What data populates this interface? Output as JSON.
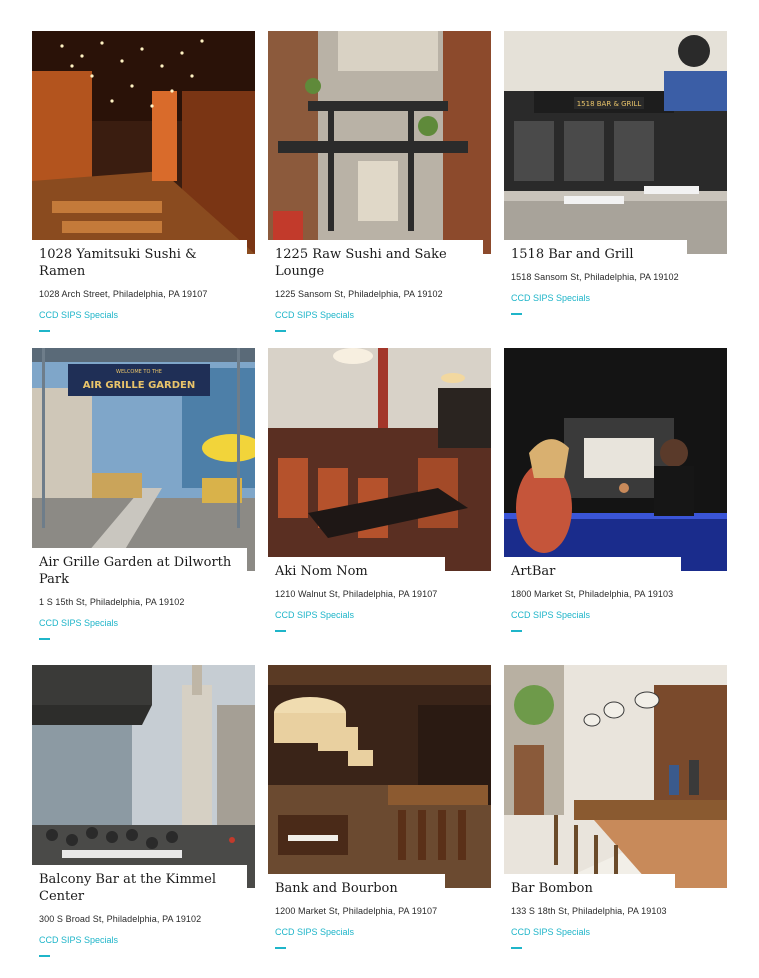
{
  "colors": {
    "accent": "#1fb5c9",
    "text": "#1b1b1b",
    "background": "#ffffff"
  },
  "listings": [
    {
      "name": "1028 Yamitsuki Sushi & Ramen",
      "address": "1028 Arch Street, Philadelphia, PA 19107",
      "tag": "CCD SIPS Specials",
      "image": "restaurant-interior-string-lights"
    },
    {
      "name": "1225 Raw Sushi and Sake Lounge",
      "address": "1225 Sansom St, Philadelphia, PA 19102",
      "tag": "CCD SIPS Specials",
      "image": "courtyard-patio-pergola"
    },
    {
      "name": "1518 Bar and Grill",
      "address": "1518 Sansom St, Philadelphia, PA 19102",
      "tag": "CCD SIPS Specials",
      "image": "storefront-sidewalk-tables",
      "sign_text": "1518 BAR & GRILL"
    },
    {
      "name": "Air Grille Garden at Dilworth Park",
      "address": "1 S 15th St, Philadelphia, PA 19102",
      "tag": "CCD SIPS Specials",
      "image": "outdoor-beer-garden",
      "sign_text": "AIR GRILLE GARDEN",
      "sign_small": "WELCOME TO THE"
    },
    {
      "name": "Aki Nom Nom",
      "address": "1210 Walnut St, Philadelphia, PA 19107",
      "tag": "CCD SIPS Specials",
      "image": "dining-room-red-booths"
    },
    {
      "name": "ArtBar",
      "address": "1800 Market St, Philadelphia, PA 19103",
      "tag": "CCD SIPS Specials",
      "image": "bartender-serving-guest"
    },
    {
      "name": "Balcony Bar at the Kimmel Center",
      "address": "300 S Broad St, Philadelphia, PA 19102",
      "tag": "CCD SIPS Specials",
      "image": "rooftop-balcony-crowd"
    },
    {
      "name": "Bank and Bourbon",
      "address": "1200 Market St, Philadelphia, PA 19107",
      "tag": "CCD SIPS Specials",
      "image": "bar-pendant-lamps"
    },
    {
      "name": "Bar Bombon",
      "address": "133 S 18th St, Philadelphia, PA 19103",
      "tag": "CCD SIPS Specials",
      "image": "tiled-bar-stools"
    }
  ]
}
